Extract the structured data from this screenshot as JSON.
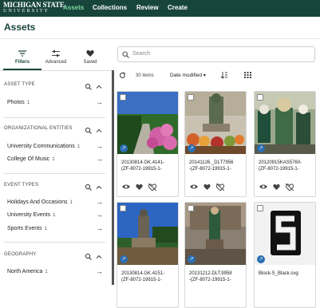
{
  "header": {
    "logo_line1": "MICHIGAN STATE",
    "logo_line2": "UNIVERSITY",
    "nav": [
      "Assets",
      "Collections",
      "Review",
      "Create"
    ]
  },
  "page_title": "Assets",
  "panel_tabs": [
    "Filters",
    "Advanced",
    "Saved"
  ],
  "facets": {
    "asset_type": {
      "title": "ASSET TYPE",
      "items": [
        {
          "label": "Photos",
          "count": "1"
        }
      ]
    },
    "org_entities": {
      "title": "ORGANIZATIONAL ENTITIES",
      "items": [
        {
          "label": "University Communications",
          "count": "1"
        },
        {
          "label": "College Of Music",
          "count": "1"
        }
      ]
    },
    "event_types": {
      "title": "EVENT TYPES",
      "items": [
        {
          "label": "Holidays And Occasions",
          "count": "1"
        },
        {
          "label": "University Events",
          "count": "1"
        },
        {
          "label": "Sports Events",
          "count": "1"
        }
      ]
    },
    "geography": {
      "title": "GEOGRAPHY",
      "items": [
        {
          "label": "North America",
          "count": "1"
        }
      ]
    }
  },
  "search": {
    "placeholder": "Search"
  },
  "toolbar": {
    "count": "30 items",
    "sort": "Date modified"
  },
  "assets": [
    {
      "line1": "20130814.GK.4141-",
      "line2": "(ZF-8072-19915-1-"
    },
    {
      "line1": "20141126._DLT7956",
      "line2": "-(ZF-8072-19915-1-"
    },
    {
      "line1": "20120915KAS5760-",
      "line2": "(ZF-8072-19915-1-"
    },
    {
      "line1": "20130814.GK.4151-",
      "line2": "(ZF-8072-19915-1-"
    },
    {
      "line1": "20131212.DLT.9958",
      "line2": "-(ZF-8072-19915-1-"
    },
    {
      "line1": "Block-S_Black.svg",
      "line2": ""
    }
  ],
  "colors": {
    "brand": "#18453b",
    "accent": "#7bd4a1",
    "badge": "#2c6fb3"
  }
}
